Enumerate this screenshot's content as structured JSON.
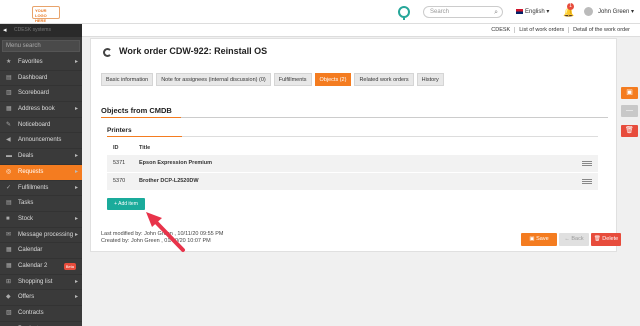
{
  "topbar": {
    "logo_text": "YOUR LOGO HERE",
    "search_placeholder": "Search",
    "language": "English",
    "notifications_count": "1",
    "user_name": "John Green"
  },
  "sidebar": {
    "header_text": "CDESK systems",
    "menu_search_placeholder": "Menu search",
    "items": [
      {
        "label": "Favorites",
        "icon": "star-icon",
        "arrow": true,
        "active": false
      },
      {
        "label": "Dashboard",
        "icon": "dashboard-icon",
        "arrow": false,
        "active": false
      },
      {
        "label": "Scoreboard",
        "icon": "chart-icon",
        "arrow": false,
        "active": false
      },
      {
        "label": "Address book",
        "icon": "book-icon",
        "arrow": true,
        "active": false
      },
      {
        "label": "Noticeboard",
        "icon": "pin-icon",
        "arrow": false,
        "active": false
      },
      {
        "label": "Announcements",
        "icon": "megaphone-icon",
        "arrow": false,
        "active": false
      },
      {
        "label": "Deals",
        "icon": "deals-icon",
        "arrow": true,
        "active": false
      },
      {
        "label": "Requests",
        "icon": "lifebuoy-icon",
        "arrow": true,
        "active": true
      },
      {
        "label": "Fulfillments",
        "icon": "check-icon",
        "arrow": true,
        "active": false
      },
      {
        "label": "Tasks",
        "icon": "tasks-icon",
        "arrow": false,
        "active": false
      },
      {
        "label": "Stock",
        "icon": "box-icon",
        "arrow": true,
        "active": false
      },
      {
        "label": "Message processing",
        "icon": "envelope-icon",
        "arrow": true,
        "active": false
      },
      {
        "label": "Calendar",
        "icon": "calendar-icon",
        "arrow": false,
        "active": false
      },
      {
        "label": "Calendar 2",
        "icon": "calendar-icon",
        "arrow": false,
        "active": false,
        "badge": "Beta"
      },
      {
        "label": "Shopping list",
        "icon": "cart-icon",
        "arrow": true,
        "active": false
      },
      {
        "label": "Offers",
        "icon": "offer-icon",
        "arrow": true,
        "active": false
      },
      {
        "label": "Contracts",
        "icon": "contract-icon",
        "arrow": false,
        "active": false
      },
      {
        "label": "Products",
        "icon": "product-icon",
        "arrow": true,
        "active": false
      }
    ]
  },
  "breadcrumbs": [
    "CDESK",
    "List of work orders",
    "Detail of the work order"
  ],
  "page": {
    "title": "Work order CDW-922: Reinstall OS",
    "tabs": [
      {
        "label": "Basic information",
        "active": false
      },
      {
        "label": "Note for assignees (internal discussion) (0)",
        "active": false
      },
      {
        "label": "Fulfillments",
        "active": false
      },
      {
        "label": "Objects (2)",
        "active": true
      },
      {
        "label": "Related work orders",
        "active": false
      },
      {
        "label": "History",
        "active": false
      }
    ],
    "section_title": "Objects from CMDB",
    "subsection_title": "Printers",
    "table": {
      "headers": [
        "ID",
        "Title"
      ],
      "rows": [
        {
          "id": "5371",
          "title": "Epson Expression Premium"
        },
        {
          "id": "5370",
          "title": "Brother DCP-L2520DW"
        }
      ]
    },
    "add_button": "+ Add item",
    "meta": {
      "modified": "Last modified by:  John Green , 10/11/20 09:55 PM",
      "created": "Created by:  John Green , 01/10/20 10:07 PM"
    },
    "buttons": {
      "save": "Save",
      "back": "Back",
      "delete": "Delete"
    }
  },
  "colors": {
    "accent": "#f47c20",
    "teal": "#1aab9b",
    "danger": "#e74c3c",
    "sidebar_bg": "#3a3a3a"
  }
}
